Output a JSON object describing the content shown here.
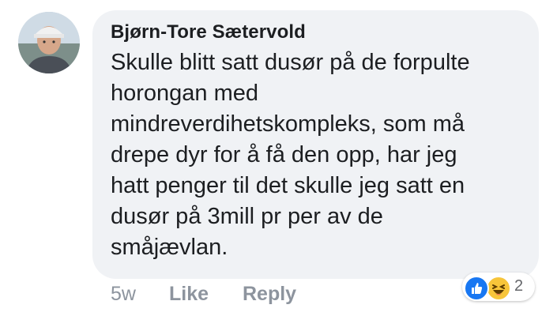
{
  "comment": {
    "author": "Bjørn-Tore Sætervold",
    "text": "Skulle blitt satt dusør på de forpulte\nhorongan med\nmindreverdihetskompleks, som må\ndrepe dyr for å få den opp, har jeg\nhatt penger til det skulle jeg satt en\ndusør på 3mill pr per av de\nsmåjævlan.",
    "timestamp": "5w",
    "like_label": "Like",
    "reply_label": "Reply",
    "reaction_count": "2",
    "reactions": [
      "like-icon",
      "haha-icon"
    ]
  },
  "colors": {
    "bubble": "#f0f2f5",
    "text": "#1c1e21",
    "meta": "#8d949e",
    "like_blue": "#1877f2",
    "haha_yellow": "#f7c53a"
  }
}
